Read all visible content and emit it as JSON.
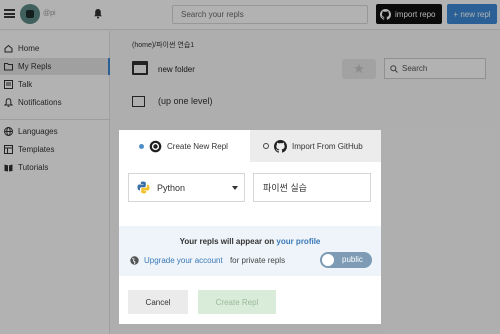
{
  "topbar": {
    "username": "@pi",
    "search_placeholder": "Search your repls",
    "import_label": "import repo",
    "new_label": "+ new repl"
  },
  "sidebar": {
    "items": [
      {
        "label": "Home",
        "icon": "home-icon"
      },
      {
        "label": "My Repls",
        "icon": "folder-icon",
        "active": true
      },
      {
        "label": "Talk",
        "icon": "talk-icon"
      },
      {
        "label": "Notifications",
        "icon": "bell-icon"
      },
      {
        "label": "Languages",
        "icon": "globe-icon"
      },
      {
        "label": "Templates",
        "icon": "templates-icon"
      },
      {
        "label": "Tutorials",
        "icon": "book-icon"
      }
    ]
  },
  "main": {
    "breadcrumb": "(home)/파이썬 연습1",
    "folder_name": "new folder",
    "up_level": "(up one level)",
    "search_placeholder": "Search"
  },
  "modal": {
    "tab_create": "Create New Repl",
    "tab_import": "Import From GitHub",
    "language": "Python",
    "repl_name": "파이썬 실습",
    "info_prefix": "Your repls will appear on ",
    "info_link": "your profile",
    "upgrade_link": "Upgrade your account",
    "upgrade_suffix": " for private repls",
    "toggle_label": "public",
    "cancel_label": "Cancel",
    "create_label": "Create Repl"
  },
  "colors": {
    "accent": "#3d8ad6",
    "link": "#3a78b6",
    "create_disabled": "#d9ecd9",
    "toggle": "#7d9bb4",
    "info_bg": "#eef4f9"
  }
}
